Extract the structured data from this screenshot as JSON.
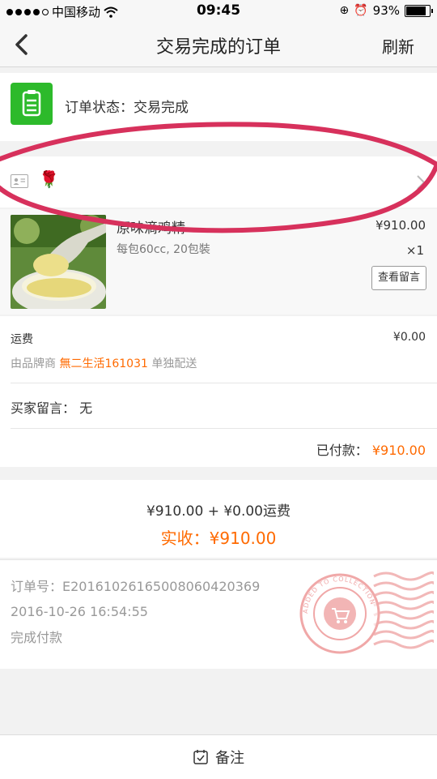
{
  "status_bar": {
    "carrier": "中国移动",
    "time": "09:45",
    "battery_text": "93%",
    "battery_level": 0.93
  },
  "nav": {
    "title": "交易完成的订单",
    "refresh_label": "刷新"
  },
  "order_status": {
    "text": "订单状态：交易完成",
    "icon": "clipboard-icon",
    "icon_color": "#2dba2b"
  },
  "shop": {
    "avatar_emoji": "🌹"
  },
  "product": {
    "name": "原味滴鸡精",
    "spec": "每包60cc, 20包裝",
    "price": "¥910.00",
    "quantity": "×1",
    "message_button": "查看留言"
  },
  "shipping": {
    "label": "运费",
    "value": "¥0.00",
    "brand_prefix": "由品牌商",
    "brand_name": "無二生活161031",
    "brand_suffix": "单独配送"
  },
  "buyer_message": {
    "text": "买家留言：  无"
  },
  "paid": {
    "label": "已付款：",
    "amount": "¥910.00"
  },
  "summary": {
    "line": "¥910.00 + ¥0.00运费",
    "real_label": "实收：",
    "real_amount": "¥910.00"
  },
  "order_info": {
    "number": "订单号：E20161026165008060420369",
    "time": "2016-10-26 16:54:55",
    "state": "完成付款",
    "stamp_text": "ADDED TO COLLECTION"
  },
  "bottom": {
    "note_label": "备注"
  },
  "colors": {
    "accent": "#ff6a00",
    "green": "#2dba2b",
    "highlight": "#d7315c"
  }
}
